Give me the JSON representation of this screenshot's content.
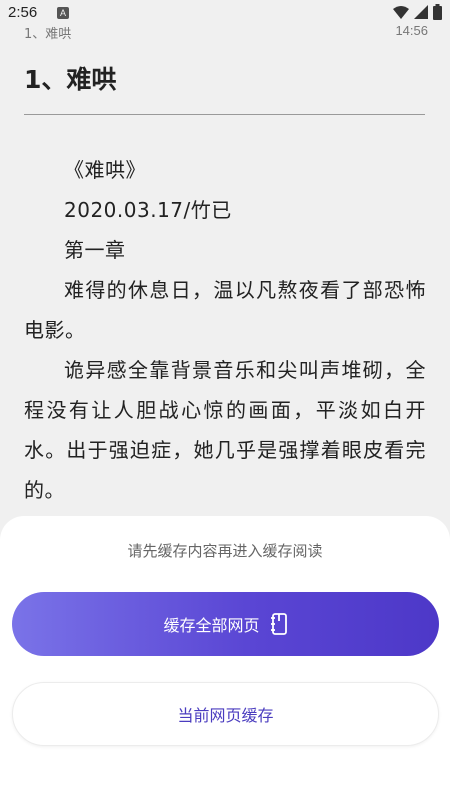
{
  "status_bar": {
    "time": "2:56",
    "notification_icon": "A",
    "icons": [
      "wifi-icon",
      "signal-icon",
      "battery-icon"
    ]
  },
  "reader_header": {
    "chapter": "1、难哄",
    "time": "14:56"
  },
  "chapter": {
    "title": "1、难哄",
    "paragraphs": [
      "《难哄》",
      "2020.03.17/竹已",
      "第一章",
      "难得的休息日，温以凡熬夜看了部恐怖电影。",
      "诡异感全靠背景音乐和尖叫声堆砌，全程没有让人胆战心惊的画面，平淡如白开水。出于强迫症，她几乎是强撑着眼皮看完的。"
    ]
  },
  "bottom_sheet": {
    "hint": "请先缓存内容再进入缓存阅读",
    "cache_all_label": "缓存全部网页",
    "cache_current_label": "当前网页缓存"
  },
  "colors": {
    "accent_gradient_start": "#7a73e8",
    "accent_gradient_end": "#4d38c8",
    "accent_text": "#4a3cbf"
  }
}
